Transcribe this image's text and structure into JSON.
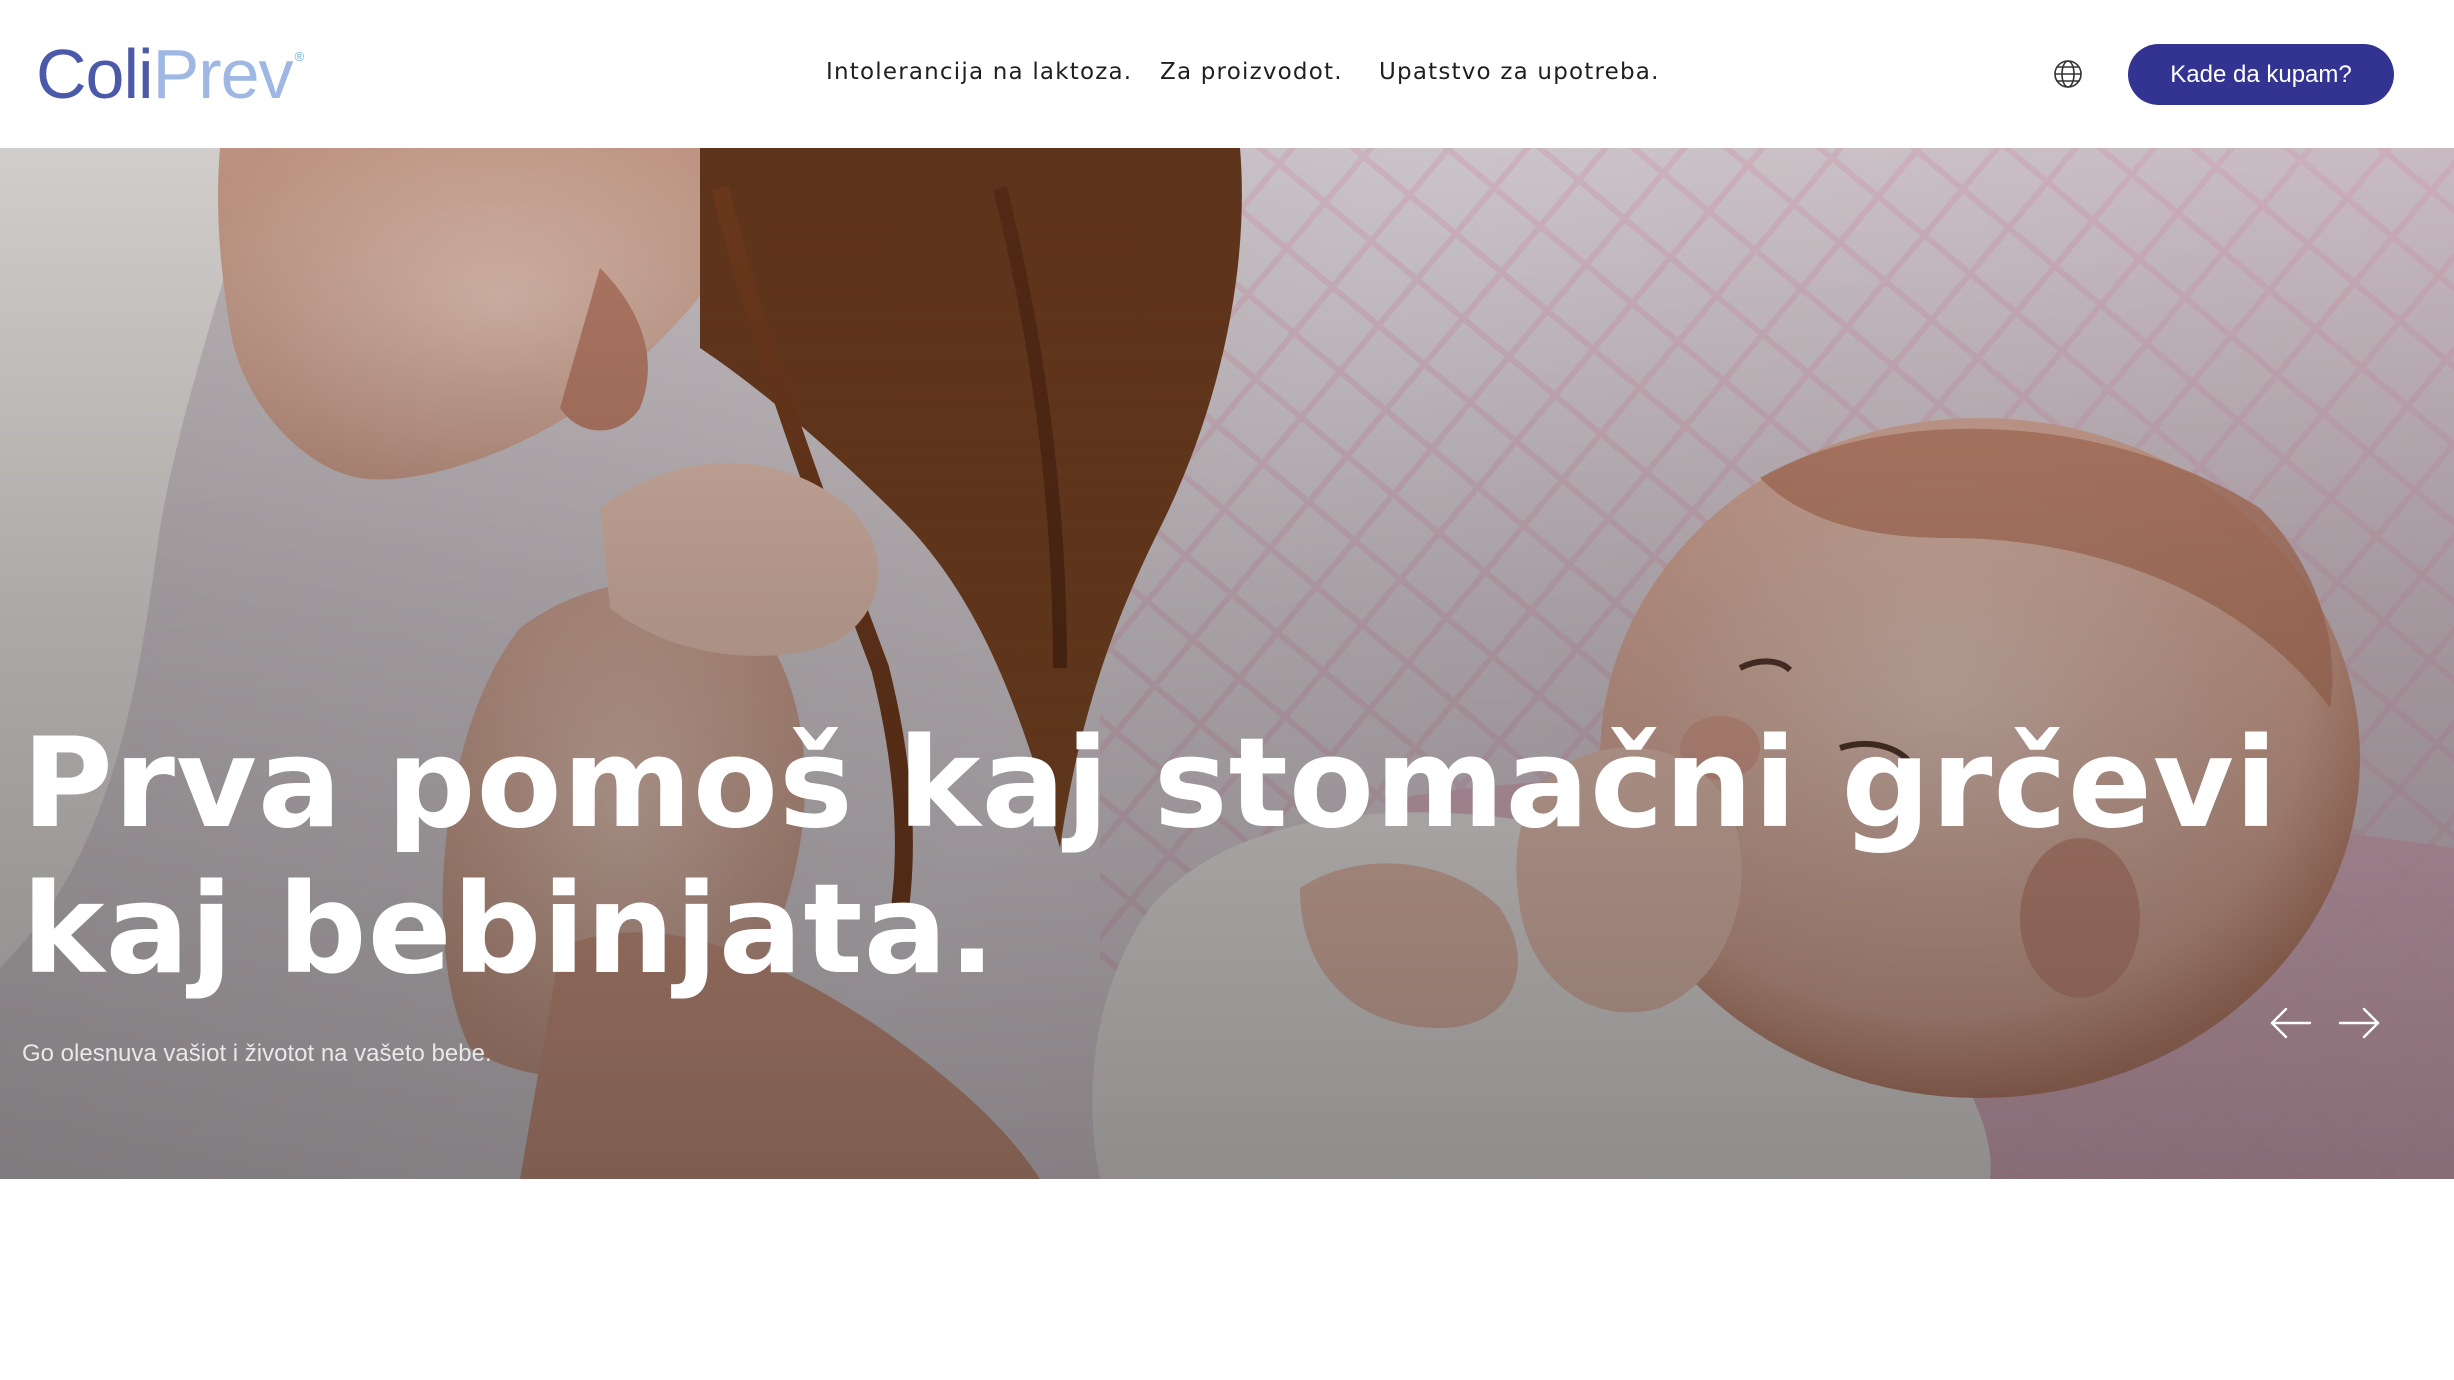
{
  "brand": {
    "logo_part1": "Coli",
    "logo_part2": "Prev",
    "logo_mark": "®",
    "colors": {
      "primary": "#4a5aa8",
      "secondary": "#9fb7e3",
      "button": "#333391"
    }
  },
  "nav": {
    "items": [
      {
        "label": "Intolerancija na laktoza."
      },
      {
        "label": "Za proizvodot."
      },
      {
        "label": "Upatstvo za upotreba."
      }
    ]
  },
  "header": {
    "language_icon": "globe-icon",
    "cta_label": "Kade da kupam?"
  },
  "hero": {
    "title": "Prva pomoš kaj stomačni grčevi kaj bebinjata.",
    "subtitle": "Go olesnuva vašiot i životot na vašeto bebe.",
    "prev_icon": "arrow-left-icon",
    "next_icon": "arrow-right-icon"
  }
}
